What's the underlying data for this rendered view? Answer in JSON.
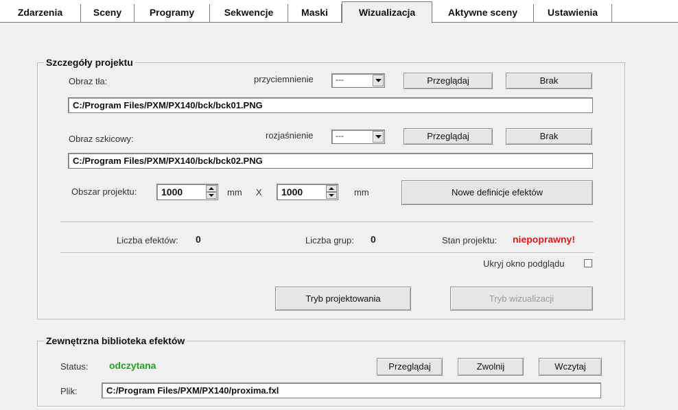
{
  "tabs": [
    {
      "label": "Zdarzenia"
    },
    {
      "label": "Sceny"
    },
    {
      "label": "Programy"
    },
    {
      "label": "Sekwencje"
    },
    {
      "label": "Maski"
    },
    {
      "label": "Wizualizacja"
    },
    {
      "label": "Aktywne sceny"
    },
    {
      "label": "Ustawienia"
    }
  ],
  "project": {
    "legend": "Szczegóły projektu",
    "background": {
      "label": "Obraz tła:",
      "mode_label": "przyciemnienie",
      "mode_value": "---",
      "browse_label": "Przeglądaj",
      "none_label": "Brak",
      "path": "C:/Program Files/PXM/PX140/bck/bck01.PNG"
    },
    "sketch": {
      "label": "Obraz szkicowy:",
      "mode_label": "rozjaśnienie",
      "mode_value": "---",
      "browse_label": "Przeglądaj",
      "none_label": "Brak",
      "path": "C:/Program Files/PXM/PX140/bck/bck02.PNG"
    },
    "area": {
      "label": "Obszar projektu:",
      "width": "1000",
      "unit1": "mm",
      "times": "X",
      "height": "1000",
      "unit2": "mm",
      "new_defs_label": "Nowe definicje efektów"
    },
    "stats": {
      "effects_label": "Liczba efektów:",
      "effects_value": "0",
      "groups_label": "Liczba grup:",
      "groups_value": "0",
      "state_label": "Stan projektu:",
      "state_value": "niepoprawny!"
    },
    "hide_preview_label": "Ukryj okno podglądu",
    "design_mode_label": "Tryb projektowania",
    "visual_mode_label": "Tryb wizualizacji"
  },
  "library": {
    "legend": "Zewnętrzna biblioteka efektów",
    "status_label": "Status:",
    "status_value": "odczytana",
    "browse_label": "Przeglądaj",
    "release_label": "Zwolnij",
    "load_label": "Wczytaj",
    "file_label": "Plik:",
    "file_path": "C:/Program Files/PXM/PX140/proxima.fxl"
  },
  "colors": {
    "error": "#d81c1c",
    "ok": "#2a9a2a"
  }
}
